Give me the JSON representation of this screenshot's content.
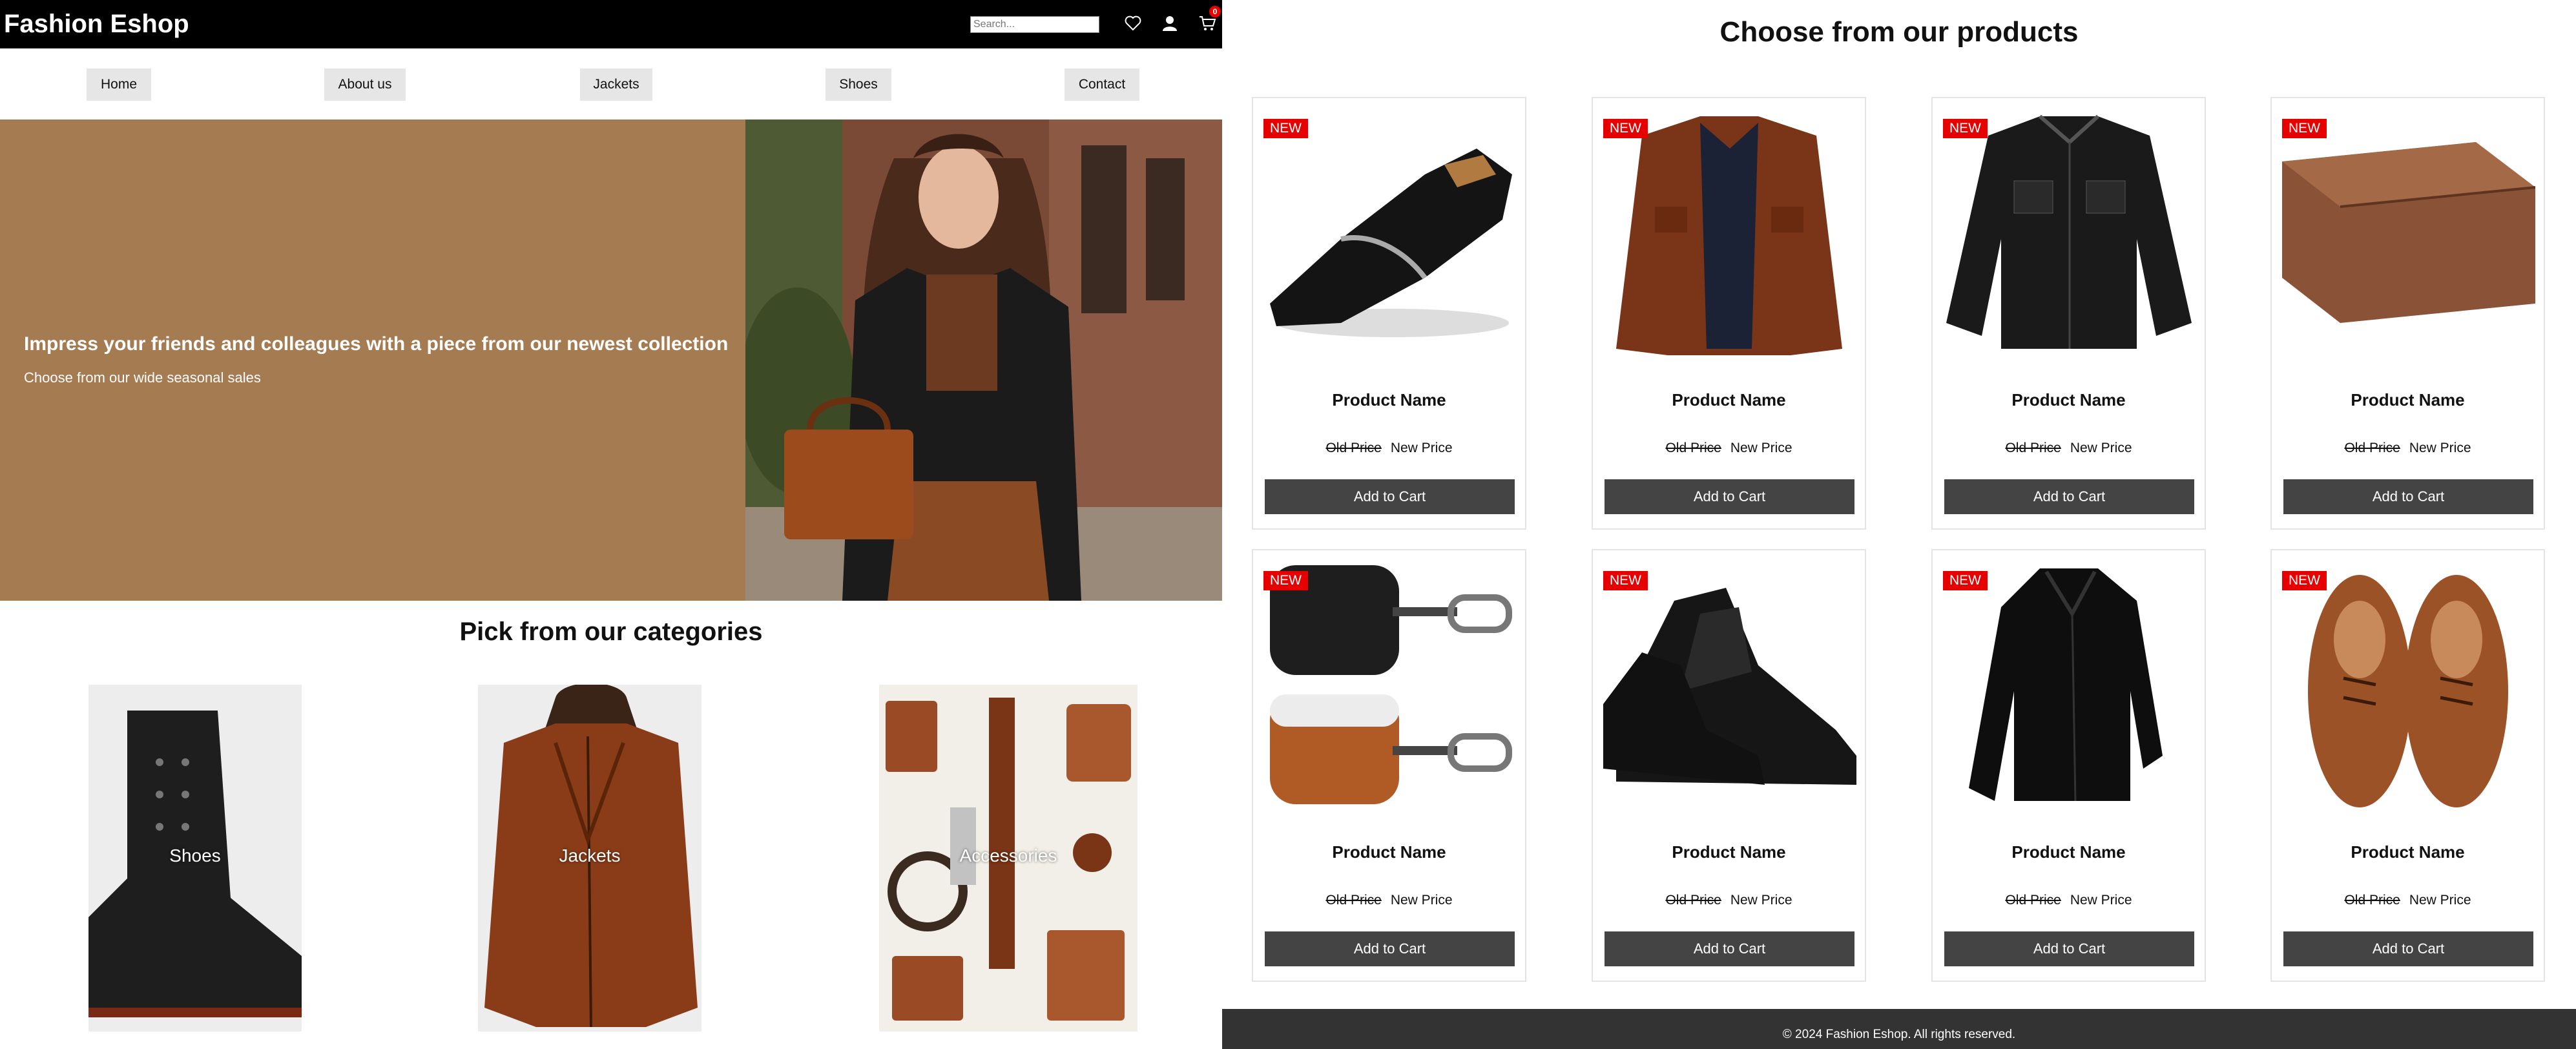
{
  "header": {
    "brand": "Fashion Eshop",
    "search_placeholder": "Search...",
    "cart_count": "0",
    "icons": [
      "heart-icon",
      "user-icon",
      "cart-icon"
    ]
  },
  "nav": {
    "items": [
      {
        "label": "Home"
      },
      {
        "label": "About us"
      },
      {
        "label": "Jackets"
      },
      {
        "label": "Shoes"
      },
      {
        "label": "Contact"
      }
    ]
  },
  "hero": {
    "title": "Impress your friends and colleagues with a piece from our newest collection",
    "subtitle": "Choose from our wide seasonal sales",
    "background": "#a57b52"
  },
  "categories": {
    "heading": "Pick from our categories",
    "items": [
      {
        "label": "Shoes"
      },
      {
        "label": "Jackets"
      },
      {
        "label": "Accessories"
      }
    ]
  },
  "products": {
    "heading": "Choose from our products",
    "badge": "NEW",
    "items": [
      {
        "name": "Product Name",
        "old_price": "Old Price",
        "new_price": "New Price",
        "button": "Add to Cart",
        "image": "loafer"
      },
      {
        "name": "Product Name",
        "old_price": "Old Price",
        "new_price": "New Price",
        "button": "Add to Cart",
        "image": "brown-jacket"
      },
      {
        "name": "Product Name",
        "old_price": "Old Price",
        "new_price": "New Price",
        "button": "Add to Cart",
        "image": "black-leather-shirt"
      },
      {
        "name": "Product Name",
        "old_price": "Old Price",
        "new_price": "New Price",
        "button": "Add to Cart",
        "image": "wallet"
      },
      {
        "name": "Product Name",
        "old_price": "Old Price",
        "new_price": "New Price",
        "button": "Add to Cart",
        "image": "airpods-cases"
      },
      {
        "name": "Product Name",
        "old_price": "Old Price",
        "new_price": "New Price",
        "button": "Add to Cart",
        "image": "black-oxfords"
      },
      {
        "name": "Product Name",
        "old_price": "Old Price",
        "new_price": "New Price",
        "button": "Add to Cart",
        "image": "black-jacket"
      },
      {
        "name": "Product Name",
        "old_price": "Old Price",
        "new_price": "New Price",
        "button": "Add to Cart",
        "image": "brown-oxfords"
      }
    ]
  },
  "footer": {
    "text": "© 2024 Fashion Eshop. All rights reserved."
  },
  "colors": {
    "accent_red": "#e60000",
    "button_dark": "#444444",
    "hero_brown": "#a57b52"
  }
}
